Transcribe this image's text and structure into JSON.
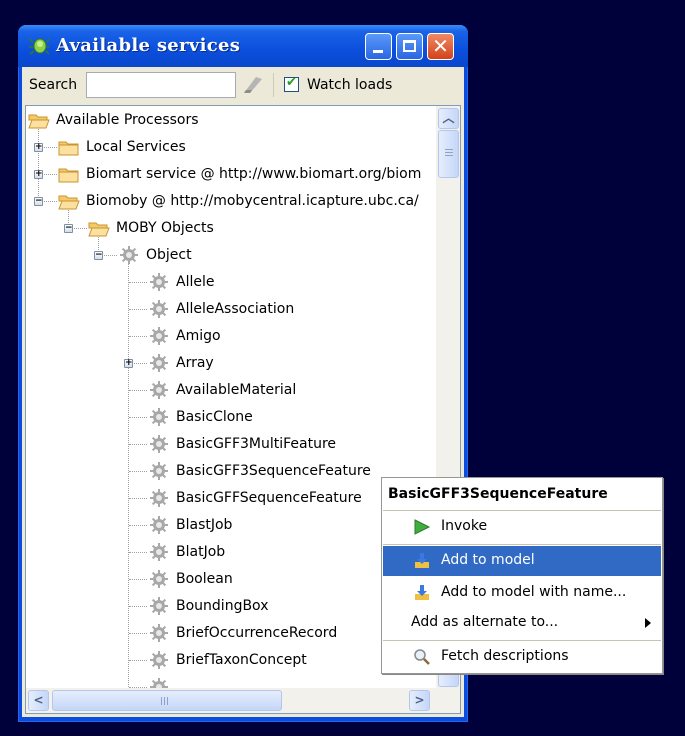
{
  "window": {
    "title": "Available services",
    "icon": "bug-icon",
    "controls": {
      "minimize": "minimize",
      "maximize": "maximize",
      "close": "close"
    }
  },
  "toolbar": {
    "search_label": "Search",
    "search_value": "",
    "search_placeholder": "",
    "watch_loads_label": "Watch loads",
    "watch_loads_checked": true
  },
  "tree": {
    "nodes": [
      {
        "label": "Available Processors",
        "icon": "folder-open-icon",
        "depth": 0,
        "expander": "none"
      },
      {
        "label": "Local Services",
        "icon": "folder-icon",
        "depth": 1,
        "expander": "plus"
      },
      {
        "label": "Biomart service @ http://www.biomart.org/biom",
        "icon": "folder-icon",
        "depth": 1,
        "expander": "plus"
      },
      {
        "label": "Biomoby @ http://mobycentral.icapture.ubc.ca/",
        "icon": "folder-open-icon",
        "depth": 1,
        "expander": "minus"
      },
      {
        "label": "MOBY Objects",
        "icon": "folder-open-icon",
        "depth": 2,
        "expander": "minus"
      },
      {
        "label": "Object",
        "icon": "gear-icon",
        "depth": 3,
        "expander": "minus"
      },
      {
        "label": "Allele",
        "icon": "gear-icon",
        "depth": 4,
        "expander": "none"
      },
      {
        "label": "AlleleAssociation",
        "icon": "gear-icon",
        "depth": 4,
        "expander": "none"
      },
      {
        "label": "Amigo",
        "icon": "gear-icon",
        "depth": 4,
        "expander": "none"
      },
      {
        "label": "Array",
        "icon": "gear-icon",
        "depth": 4,
        "expander": "plus"
      },
      {
        "label": "AvailableMaterial",
        "icon": "gear-icon",
        "depth": 4,
        "expander": "none"
      },
      {
        "label": "BasicClone",
        "icon": "gear-icon",
        "depth": 4,
        "expander": "none"
      },
      {
        "label": "BasicGFF3MultiFeature",
        "icon": "gear-icon",
        "depth": 4,
        "expander": "none"
      },
      {
        "label": "BasicGFF3SequenceFeature",
        "icon": "gear-icon",
        "depth": 4,
        "expander": "none"
      },
      {
        "label": "BasicGFFSequenceFeature",
        "icon": "gear-icon",
        "depth": 4,
        "expander": "none"
      },
      {
        "label": "BlastJob",
        "icon": "gear-icon",
        "depth": 4,
        "expander": "none"
      },
      {
        "label": "BlatJob",
        "icon": "gear-icon",
        "depth": 4,
        "expander": "none"
      },
      {
        "label": "Boolean",
        "icon": "gear-icon",
        "depth": 4,
        "expander": "none"
      },
      {
        "label": "BoundingBox",
        "icon": "gear-icon",
        "depth": 4,
        "expander": "none"
      },
      {
        "label": "BriefOccurrenceRecord",
        "icon": "gear-icon",
        "depth": 4,
        "expander": "none"
      },
      {
        "label": "BriefTaxonConcept",
        "icon": "gear-icon",
        "depth": 4,
        "expander": "none"
      },
      {
        "label": "",
        "icon": "gear-icon",
        "depth": 4,
        "expander": "none"
      }
    ]
  },
  "context_menu": {
    "title": "BasicGFF3SequenceFeature",
    "items": [
      {
        "label": "Invoke",
        "icon": "play-icon",
        "highlighted": false
      },
      {
        "label": "Add to model",
        "icon": "add-to-model-icon",
        "highlighted": true
      },
      {
        "label": "Add to model with name...",
        "icon": "add-to-model-icon",
        "highlighted": false
      },
      {
        "label": "Add as alternate to...",
        "icon": "",
        "submenu": true,
        "highlighted": false
      },
      {
        "label": "Fetch descriptions",
        "icon": "magnifier-icon",
        "highlighted": false
      }
    ]
  }
}
